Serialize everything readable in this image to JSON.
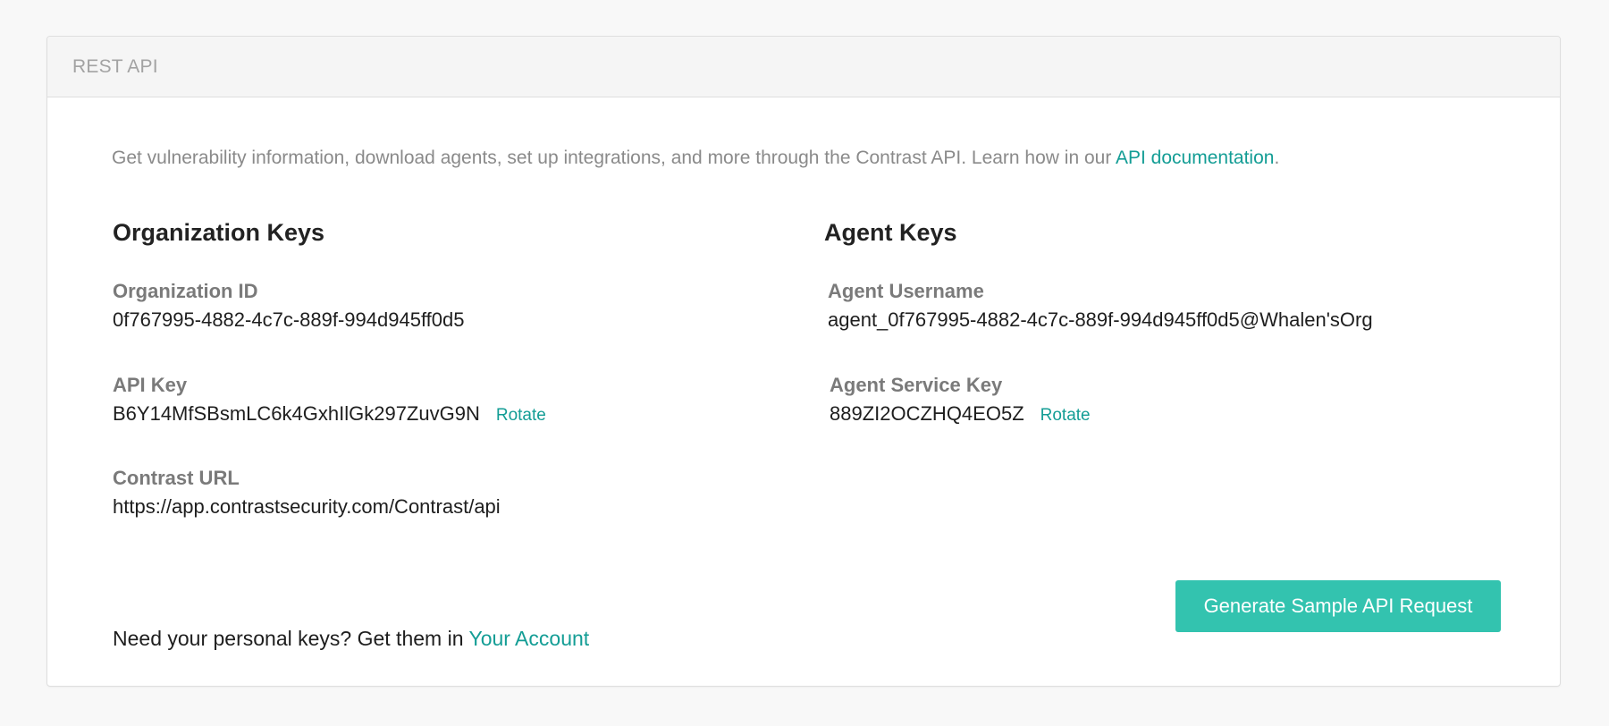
{
  "panel": {
    "title": "REST API"
  },
  "intro": {
    "text": "Get vulnerability information, download agents, set up integrations, and more through the Contrast API. Learn how in our ",
    "link_text": "API documentation",
    "suffix": "."
  },
  "org_keys": {
    "title": "Organization Keys",
    "org_id_label": "Organization ID",
    "org_id_value": "0f767995-4882-4c7c-889f-994d945ff0d5",
    "api_key_label": "API Key",
    "api_key_value": "B6Y14MfSBsmLC6k4GxhIlGk297ZuvG9N",
    "api_key_rotate": "Rotate",
    "url_label": "Contrast URL",
    "url_value": "https://app.contrastsecurity.com/Contrast/api"
  },
  "agent_keys": {
    "title": "Agent Keys",
    "username_label": "Agent Username",
    "username_value": "agent_0f767995-4882-4c7c-889f-994d945ff0d5@Whalen'sOrg",
    "service_key_label": "Agent Service Key",
    "service_key_value": "889ZI2OCZHQ4EO5Z",
    "service_key_rotate": "Rotate"
  },
  "footer": {
    "personal_text": "Need your personal keys? Get them in ",
    "personal_link": "Your Account",
    "generate_button": "Generate Sample API Request"
  },
  "colors": {
    "accent_link": "#139d95",
    "button_bg": "#33c3af",
    "header_bg": "#f5f5f5"
  }
}
